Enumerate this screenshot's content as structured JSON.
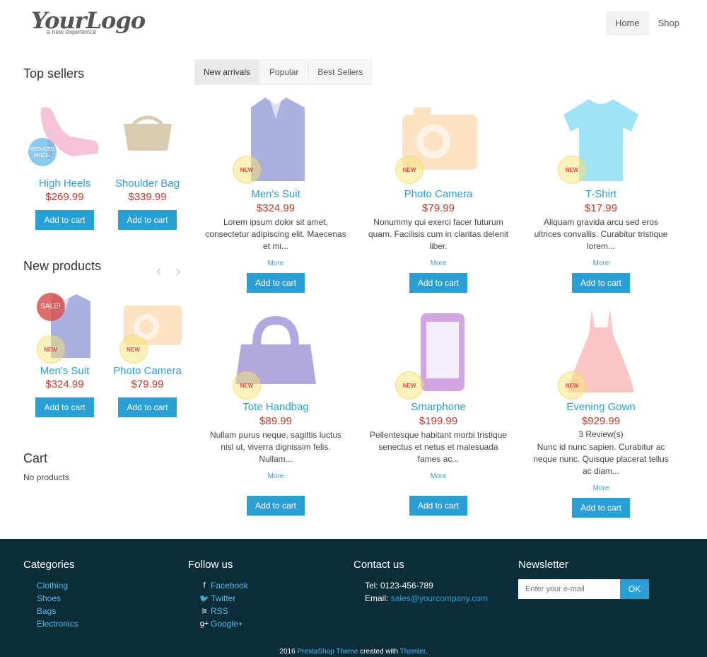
{
  "header": {
    "logo_main": "YourLogo",
    "logo_sub": "a new experience",
    "nav": [
      "Home",
      "Shop"
    ]
  },
  "sidebar": {
    "top_sellers_title": "Top sellers",
    "top_sellers": [
      {
        "name": "High Heels",
        "price": "$269.99",
        "badge": "REDUCED PRICE!",
        "button": "Add to cart"
      },
      {
        "name": "Shoulder Bag",
        "price": "$339.99",
        "button": "Add to cart"
      }
    ],
    "new_products_title": "New products",
    "arrows": {
      "prev": "‹",
      "next": "›"
    },
    "new_products": [
      {
        "name": "Men's Suit",
        "price": "$324.99",
        "badge_sale": "SALE!",
        "badge_new": "NEW",
        "button": "Add to cart"
      },
      {
        "name": "Photo Camera",
        "price": "$79.99",
        "badge_new": "NEW",
        "button": "Add to cart"
      }
    ],
    "cart_title": "Cart",
    "cart_empty": "No products"
  },
  "tabs": [
    "New arrivals",
    "Popular",
    "Best Sellers"
  ],
  "products": [
    {
      "name": "Men's Suit",
      "price": "$324.99",
      "desc": "Lorem ipsum dolor sit amet, consectetur adipiscing elit. Maecenas et mi...",
      "more": "More",
      "button": "Add to cart",
      "badge": "NEW"
    },
    {
      "name": "Photo Camera",
      "price": "$79.99",
      "desc": "Nonummy qui exerci facer futurum quam. Facilisis cum in claritas delenit liber.",
      "more": "More",
      "button": "Add to cart",
      "badge": "NEW"
    },
    {
      "name": "T-Shirt",
      "price": "$17.99",
      "desc": "Aliquam gravida arcu sed eros ultrices convallis. Curabitur tristique lorem...",
      "more": "More",
      "button": "Add to cart",
      "badge": "NEW"
    },
    {
      "name": "Tote Handbag",
      "price": "$89.99",
      "desc": "Nullam purus neque, sagittis luctus nisl ut, viverra dignissim felis. Nullam...",
      "more": "More",
      "button": "Add to cart",
      "badge": "NEW"
    },
    {
      "name": "Smarphone",
      "price": "$199.99",
      "desc": "Pellentesque habitant morbi tristique senectus et netus et malesuada fames ac...",
      "more": "More",
      "button": "Add to cart",
      "badge": "NEW"
    },
    {
      "name": "Evening Gown",
      "price": "$929.99",
      "reviews": "3 Review(s)",
      "desc": "Nunc id nunc sapien. Curabitur ac neque nunc. Quisque placerat tellus ac diam...",
      "more": "More",
      "button": "Add to cart",
      "badge": "NEW"
    }
  ],
  "footer": {
    "categories_title": "Categories",
    "categories": [
      "Clothing",
      "Shoes",
      "Bags",
      "Electronics"
    ],
    "follow_title": "Follow us",
    "follow": [
      {
        "label": "Facebook",
        "icon": "f"
      },
      {
        "label": "Twitter",
        "icon": "🐦"
      },
      {
        "label": "RSS",
        "icon": "⚞"
      },
      {
        "label": "Google+",
        "icon": "g+"
      }
    ],
    "contact_title": "Contact us",
    "tel": "Tel: 0123-456-789",
    "email_label": "Email: ",
    "email": "sales@yourcompany.com",
    "newsletter_title": "Newsletter",
    "newsletter_placeholder": "Enter your e-mail",
    "newsletter_button": "OK",
    "copyright_year": "2016 ",
    "copyright_theme": "PrestaShop Theme",
    "copyright_mid": " created with ",
    "copyright_tool": "Themler",
    "copyright_end": "."
  },
  "colors": {
    "accent": "#2a9fd6",
    "price": "#c0392b",
    "footer_bg": "#0b2d3a"
  }
}
